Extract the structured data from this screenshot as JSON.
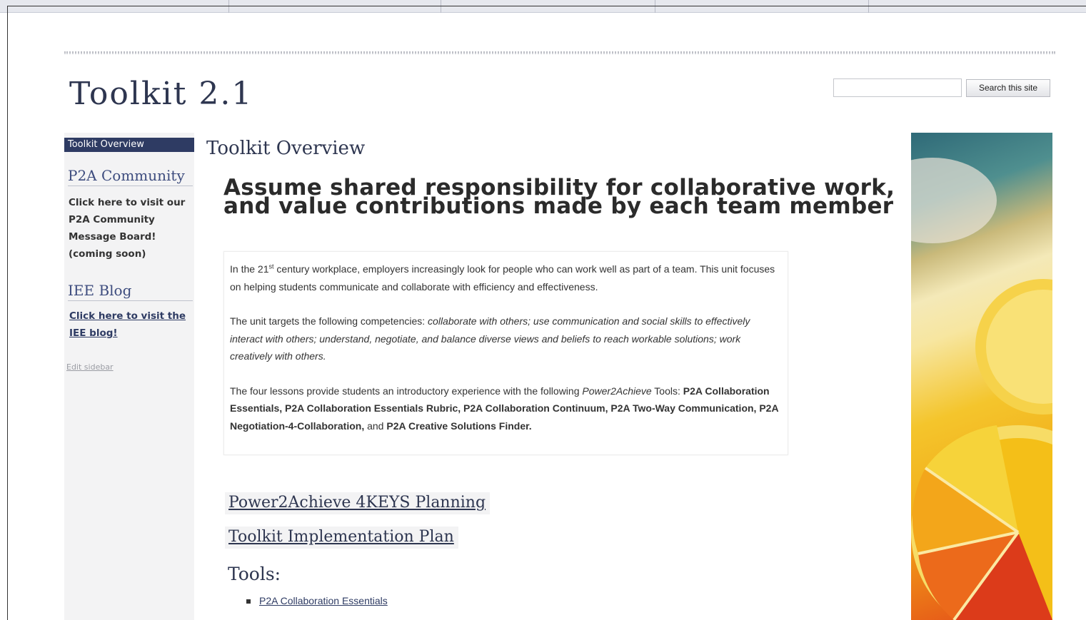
{
  "site": {
    "title": "Toolkit 2.1",
    "search_placeholder": "",
    "search_button": "Search this site"
  },
  "sidebar": {
    "active_item": "Toolkit Overview",
    "p2a_heading": "P2A Community",
    "p2a_text": "Click here to visit our P2A Community Message Board! (coming soon)",
    "iee_heading": "IEE Blog",
    "iee_link": "Click here to visit the IEE blog!",
    "edit_link": "Edit sidebar"
  },
  "main": {
    "page_title": "Toolkit Overview",
    "headline": "Assume shared responsibility for collaborative work, and value contributions made by each team member",
    "para1": {
      "before_sup": "In the 21",
      "sup": "st",
      "after_sup": " century workplace, employers increasingly look for people who can work well as part of a team. This unit focuses on helping students communicate and collaborate with efficiency and effectiveness."
    },
    "para2": {
      "lead": "The unit targets the following competencies: ",
      "competencies": "collaborate with others; use communication and social skills to effectively interact with others; understand, negotiate, and balance diverse views and beliefs to reach workable solutions; work creatively with others."
    },
    "para3": {
      "lead": "The four lessons provide students an introductory experience with the following ",
      "brand": "Power2Achieve",
      "tools_word": " Tools: ",
      "tools_bold": "P2A Collaboration Essentials, P2A Collaboration Essentials Rubric, P2A Collaboration Continuum, P2A Two-Way Communication, P2A Negotiation-4-Collaboration,",
      "and_word": " and ",
      "last_tool": "P2A Creative Solutions Finder."
    },
    "link_planning": "Power2Achieve 4KEYS Planning",
    "link_implementation": "Toolkit Implementation Plan",
    "tools_heading": "Tools:",
    "tools": [
      "P2A Collaboration Essentials"
    ]
  },
  "decor": {
    "image": "citrus-slices-photo"
  }
}
